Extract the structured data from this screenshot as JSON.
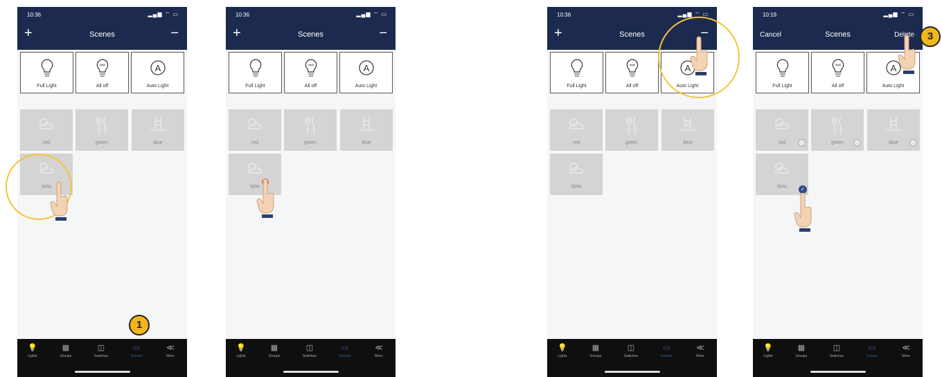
{
  "phones": [
    {
      "time": "10:36",
      "signal": "▂▄▆ ⌔ ▭",
      "nav": {
        "left": "+",
        "title": "Scenes",
        "right": "−"
      },
      "fixed": [
        "Full Light",
        "All off",
        "Auto Light"
      ],
      "scenes": [
        "red",
        "green",
        "blue",
        "50%"
      ]
    },
    {
      "time": "10:36",
      "signal": "▂▄▆ ⌔ ▭",
      "nav": {
        "left": "+",
        "title": "Scenes",
        "right": "−"
      },
      "fixed": [
        "Full Light",
        "All off",
        "Auto Light"
      ],
      "scenes": [
        "red",
        "green",
        "blue",
        "50%"
      ]
    },
    {
      "time": "10:36",
      "signal": "▂▄▆ ⌔ ▭",
      "nav": {
        "left": "+",
        "title": "Scenes",
        "right": "−"
      },
      "fixed": [
        "Full Light",
        "All off",
        "Auto Light"
      ],
      "scenes": [
        "red",
        "green",
        "blue",
        "50%"
      ]
    },
    {
      "time": "10:19",
      "signal": "▂▄▆ ⌔ ▭",
      "nav": {
        "left": "Cancel",
        "title": "Scenes",
        "right": "Delete"
      },
      "fixed": [
        "Full Light",
        "All off",
        "Auto Light"
      ],
      "scenes": [
        "red",
        "green",
        "blue",
        "50%"
      ]
    }
  ],
  "tabs": [
    "Lights",
    "Groups",
    "Switches",
    "Scenes",
    "More"
  ],
  "tab_icons": [
    "💡",
    "▦",
    "◫",
    "▭",
    "≪"
  ],
  "steps": {
    "one": "1",
    "three": "3"
  },
  "colors": {
    "navy": "#1b2a4e",
    "accent": "#f4c43a",
    "active_tab": "#3c5aa0"
  }
}
